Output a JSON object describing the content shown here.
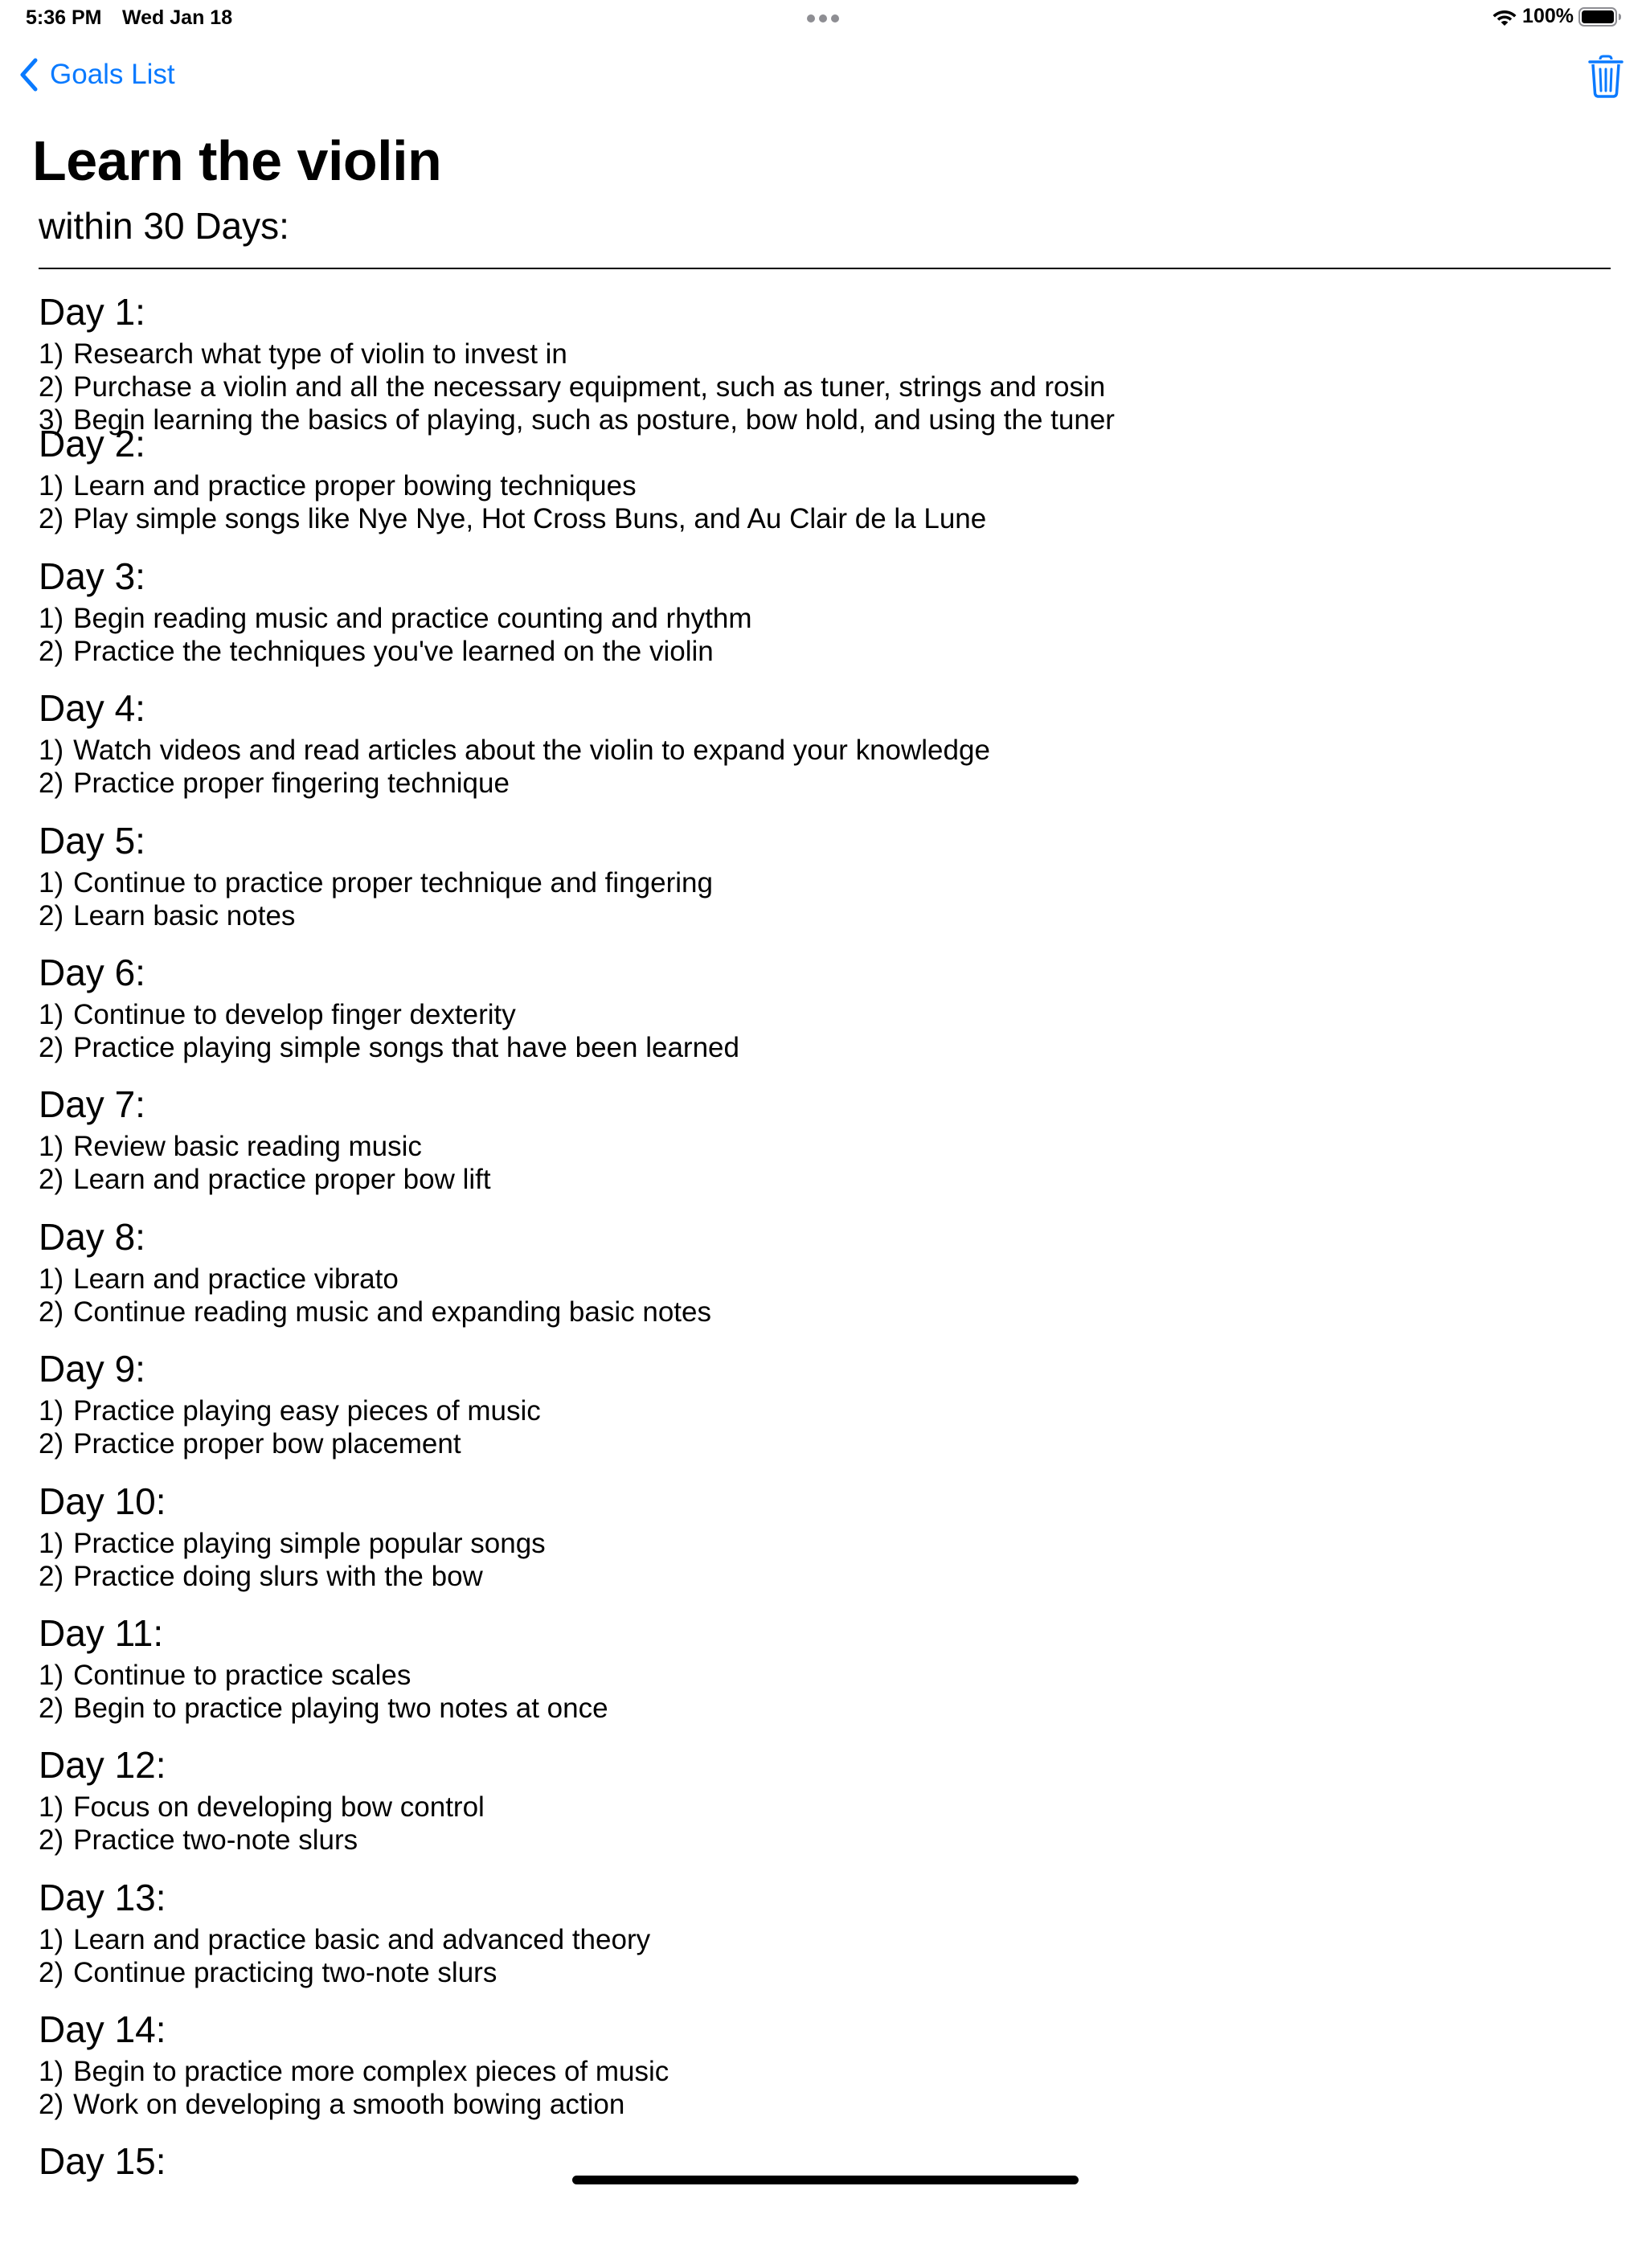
{
  "status_bar": {
    "time": "5:36 PM",
    "date": "Wed Jan 18",
    "battery": "100%"
  },
  "nav": {
    "back_label": "Goals List",
    "icons": {
      "back": "chevron-left-icon",
      "delete": "trash-icon"
    },
    "accent_color": "#0a7aff"
  },
  "goal": {
    "title": "Learn the violin",
    "subtitle": "within 30 Days:"
  },
  "days": [
    {
      "heading": "Day 1:",
      "tasks": [
        {
          "num": "1)",
          "text": "Research what type of violin to invest in"
        },
        {
          "num": "2)",
          "text": "Purchase a violin and all the necessary equipment, such as tuner, strings and rosin"
        },
        {
          "num": "3)",
          "text": "Begin learning the basics of playing, such as posture, bow hold, and using the tuner"
        }
      ]
    },
    {
      "heading": "Day 2:",
      "tasks": [
        {
          "num": "1)",
          "text": "Learn and practice proper bowing techniques"
        },
        {
          "num": "2)",
          "text": "Play simple songs like Nye Nye, Hot Cross Buns, and Au Clair de la Lune"
        }
      ]
    },
    {
      "heading": "Day 3:",
      "tasks": [
        {
          "num": "1)",
          "text": "Begin reading music and practice counting and rhythm"
        },
        {
          "num": "2)",
          "text": "Practice the techniques you've learned on the violin"
        }
      ]
    },
    {
      "heading": "Day 4:",
      "tasks": [
        {
          "num": "1)",
          "text": "Watch videos and read articles about the violin to expand your knowledge"
        },
        {
          "num": "2)",
          "text": "Practice proper fingering technique"
        }
      ]
    },
    {
      "heading": "Day 5:",
      "tasks": [
        {
          "num": "1)",
          "text": "Continue to practice proper technique and fingering"
        },
        {
          "num": "2)",
          "text": "Learn basic notes"
        }
      ]
    },
    {
      "heading": "Day 6:",
      "tasks": [
        {
          "num": "1)",
          "text": "Continue to develop finger dexterity"
        },
        {
          "num": "2)",
          "text": "Practice playing simple songs that have been learned"
        }
      ]
    },
    {
      "heading": "Day 7:",
      "tasks": [
        {
          "num": "1)",
          "text": "Review basic reading music"
        },
        {
          "num": "2)",
          "text": "Learn and practice proper bow lift"
        }
      ]
    },
    {
      "heading": "Day 8:",
      "tasks": [
        {
          "num": "1)",
          "text": "Learn and practice vibrato"
        },
        {
          "num": "2)",
          "text": "Continue reading music and expanding basic notes"
        }
      ]
    },
    {
      "heading": "Day 9:",
      "tasks": [
        {
          "num": "1)",
          "text": "Practice playing easy pieces of music"
        },
        {
          "num": "2)",
          "text": "Practice proper bow placement"
        }
      ]
    },
    {
      "heading": "Day 10:",
      "tasks": [
        {
          "num": "1)",
          "text": "Practice playing simple popular songs"
        },
        {
          "num": "2)",
          "text": "Practice doing slurs with the bow"
        }
      ]
    },
    {
      "heading": "Day 11:",
      "tasks": [
        {
          "num": "1)",
          "text": "Continue to practice scales"
        },
        {
          "num": "2)",
          "text": "Begin to practice playing two notes at once"
        }
      ]
    },
    {
      "heading": "Day 12:",
      "tasks": [
        {
          "num": "1)",
          "text": "Focus on developing bow control"
        },
        {
          "num": "2)",
          "text": "Practice two-note slurs"
        }
      ]
    },
    {
      "heading": "Day 13:",
      "tasks": [
        {
          "num": "1)",
          "text": "Learn and practice basic and advanced theory"
        },
        {
          "num": "2)",
          "text": "Continue practicing two-note slurs"
        }
      ]
    },
    {
      "heading": "Day 14:",
      "tasks": [
        {
          "num": "1)",
          "text": "Begin to practice more complex pieces of music"
        },
        {
          "num": "2)",
          "text": "Work on developing a smooth bowing action"
        }
      ]
    },
    {
      "heading": "Day 15:",
      "tasks": []
    }
  ]
}
